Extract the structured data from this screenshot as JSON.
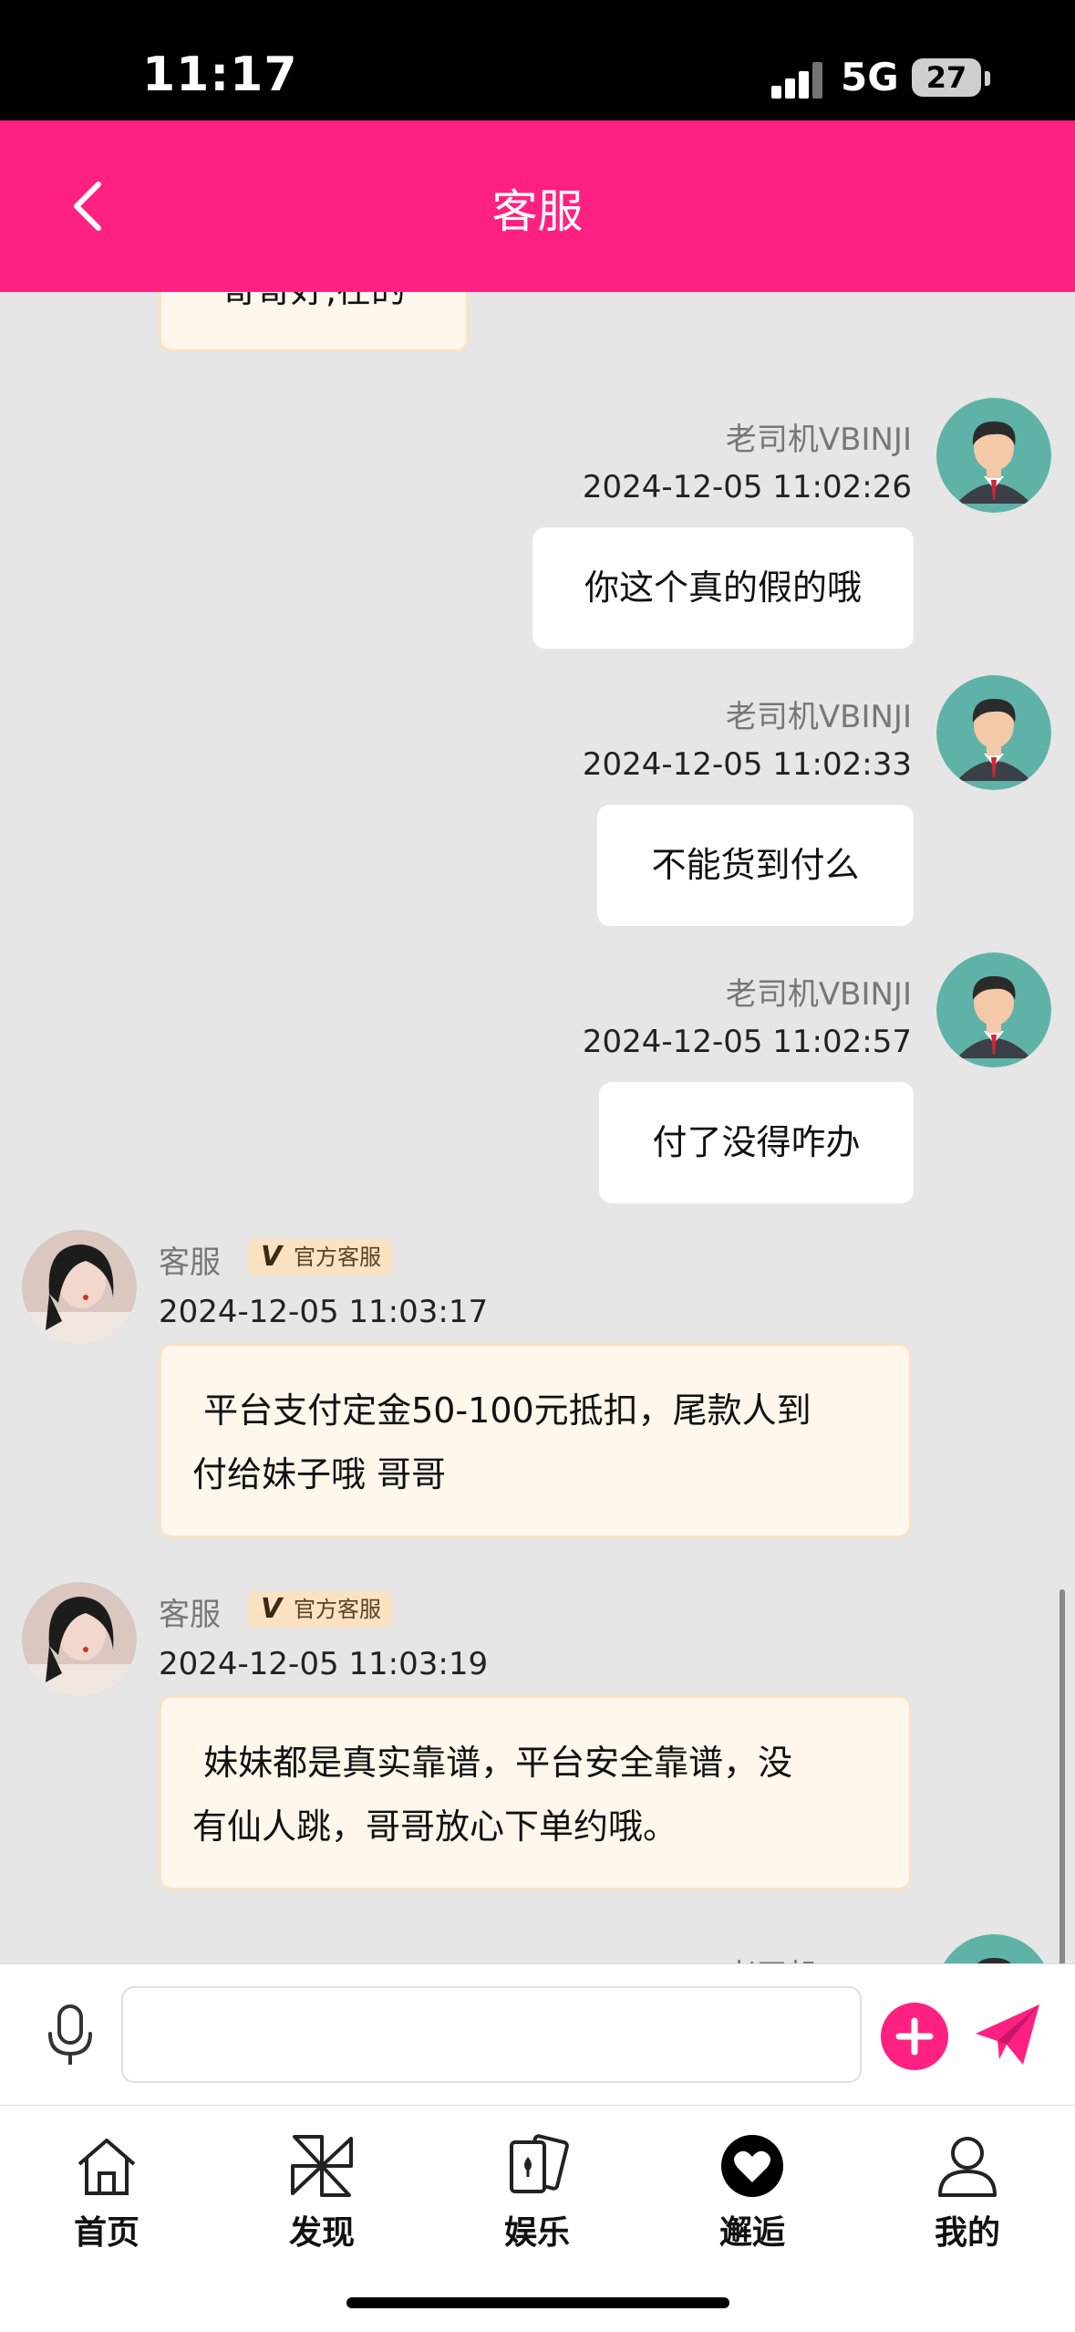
{
  "status_bar": {
    "time": "11:17",
    "network": "5G",
    "battery": "27"
  },
  "header": {
    "title": "客服",
    "back_icon": "chevron-left-icon"
  },
  "chat": {
    "partial_top_bubble": "哥哥好,在的",
    "messages": [
      {
        "from": "me",
        "name": "老司机VBINJI",
        "time": "2024-12-05 11:02:26",
        "text": "你这个真的假的哦"
      },
      {
        "from": "me",
        "name": "老司机VBINJI",
        "time": "2024-12-05 11:02:33",
        "text": "不能货到付么"
      },
      {
        "from": "me",
        "name": "老司机VBINJI",
        "time": "2024-12-05 11:02:57",
        "text": "付了没得咋办"
      },
      {
        "from": "agent",
        "name": "客服",
        "badge": "官方客服",
        "time": "2024-12-05 11:03:17",
        "line1": " 平台支付定金50-100元抵扣，尾款人到",
        "line2": "付给妹子哦 哥哥"
      },
      {
        "from": "agent",
        "name": "客服",
        "badge": "官方客服",
        "time": "2024-12-05 11:03:19",
        "line1": " 妹妹都是真实靠谱，平台安全靠谱，没",
        "line2": "有仙人跳，哥哥放心下单约哦。"
      },
      {
        "from": "me",
        "name": "老司机VBINJI"
      }
    ]
  },
  "input_bar": {
    "placeholder": "",
    "mic_icon": "microphone-icon",
    "plus_icon": "plus-icon",
    "send_icon": "send-icon"
  },
  "tabs": [
    {
      "label": "首页",
      "icon": "home-icon"
    },
    {
      "label": "发现",
      "icon": "pinwheel-icon"
    },
    {
      "label": "娱乐",
      "icon": "cards-icon"
    },
    {
      "label": "邂逅",
      "icon": "heart-icon"
    },
    {
      "label": "我的",
      "icon": "user-icon"
    }
  ],
  "colors": {
    "accent": "#ff2181",
    "chat_bg": "#e6e6e6",
    "agent_bubble": "#fff6ec",
    "badge_bg": "#fbe2c3"
  }
}
